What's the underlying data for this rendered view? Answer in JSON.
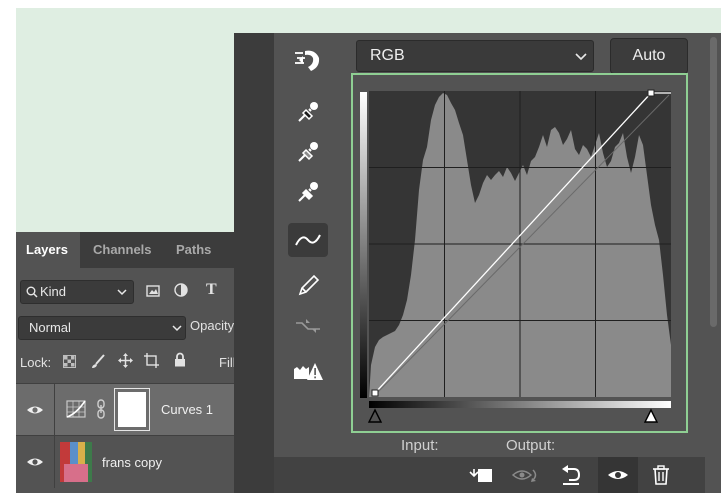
{
  "layers_panel": {
    "tabs": [
      {
        "label": "Layers",
        "active": true
      },
      {
        "label": "Channels",
        "active": false
      },
      {
        "label": "Paths",
        "active": false
      }
    ],
    "filter_kind": "Kind",
    "blend_mode": "Normal",
    "opacity_label": "Opacity",
    "lock_label": "Lock:",
    "fill_label": "Fill",
    "layers": [
      {
        "name": "Curves 1",
        "type": "adjustment",
        "visible": true,
        "selected": true
      },
      {
        "name": "frans copy",
        "type": "image",
        "visible": true,
        "selected": false
      }
    ]
  },
  "properties_panel": {
    "channel": "RGB",
    "auto_button": "Auto",
    "input_label": "Input:",
    "output_label": "Output:",
    "tools": [
      "on-image-adjust-icon",
      "black-point-eyedropper-icon",
      "gray-point-eyedropper-icon",
      "white-point-eyedropper-icon",
      "curve-point-icon",
      "pencil-icon",
      "smooth-icon",
      "clipping-warning-icon"
    ],
    "active_tool": "curve-point-icon",
    "bottom_icons": [
      "clip-to-layer-icon",
      "view-previous-state-icon",
      "reset-icon",
      "visibility-eye-icon",
      "trash-icon"
    ]
  },
  "colors": {
    "panel_bg": "#535353",
    "dark_bg": "#3c3c3c",
    "graph_highlight": "#8fcf93",
    "histogram": "#8a8a8a",
    "backdrop": "#dfeee2"
  }
}
